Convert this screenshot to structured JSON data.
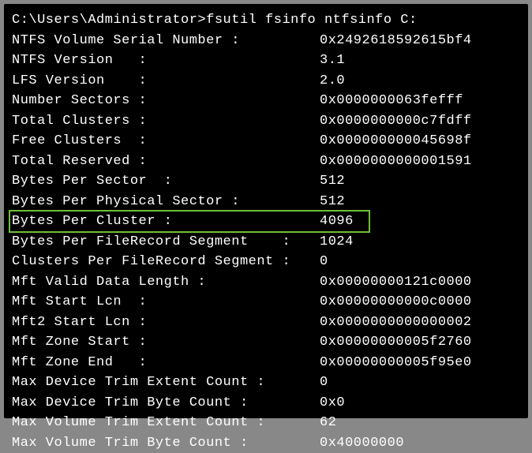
{
  "prompt": "C:\\Users\\Administrator>",
  "command": "fsutil fsinfo ntfsinfo C:",
  "rows": [
    {
      "label": "NTFS Volume Serial Number :         ",
      "value": "0x2492618592615bf4"
    },
    {
      "label": "NTFS Version   :                    ",
      "value": "3.1"
    },
    {
      "label": "LFS Version    :                    ",
      "value": "2.0"
    },
    {
      "label": "Number Sectors :                    ",
      "value": "0x0000000063fefff"
    },
    {
      "label": "Total Clusters :                    ",
      "value": "0x0000000000c7fdff"
    },
    {
      "label": "Free Clusters  :                    ",
      "value": "0x000000000045698f"
    },
    {
      "label": "Total Reserved :                    ",
      "value": "0x0000000000001591"
    },
    {
      "label": "Bytes Per Sector  :                 ",
      "value": "512"
    },
    {
      "label": "Bytes Per Physical Sector :         ",
      "value": "512"
    },
    {
      "label": "Bytes Per Cluster :                 ",
      "value": "4096",
      "highlight": true
    },
    {
      "label": "Bytes Per FileRecord Segment    :   ",
      "value": "1024"
    },
    {
      "label": "Clusters Per FileRecord Segment :   ",
      "value": "0"
    },
    {
      "label": "Mft Valid Data Length :             ",
      "value": "0x00000000121c0000"
    },
    {
      "label": "Mft Start Lcn  :                    ",
      "value": "0x00000000000c0000"
    },
    {
      "label": "Mft2 Start Lcn :                    ",
      "value": "0x0000000000000002"
    },
    {
      "label": "Mft Zone Start :                    ",
      "value": "0x00000000005f2760"
    },
    {
      "label": "Mft Zone End   :                    ",
      "value": "0x00000000005f95e0"
    },
    {
      "label": "Max Device Trim Extent Count :      ",
      "value": "0"
    },
    {
      "label": "Max Device Trim Byte Count :        ",
      "value": "0x0"
    },
    {
      "label": "Max Volume Trim Extent Count :      ",
      "value": "62"
    },
    {
      "label": "Max Volume Trim Byte Count :        ",
      "value": "0x40000000"
    }
  ]
}
